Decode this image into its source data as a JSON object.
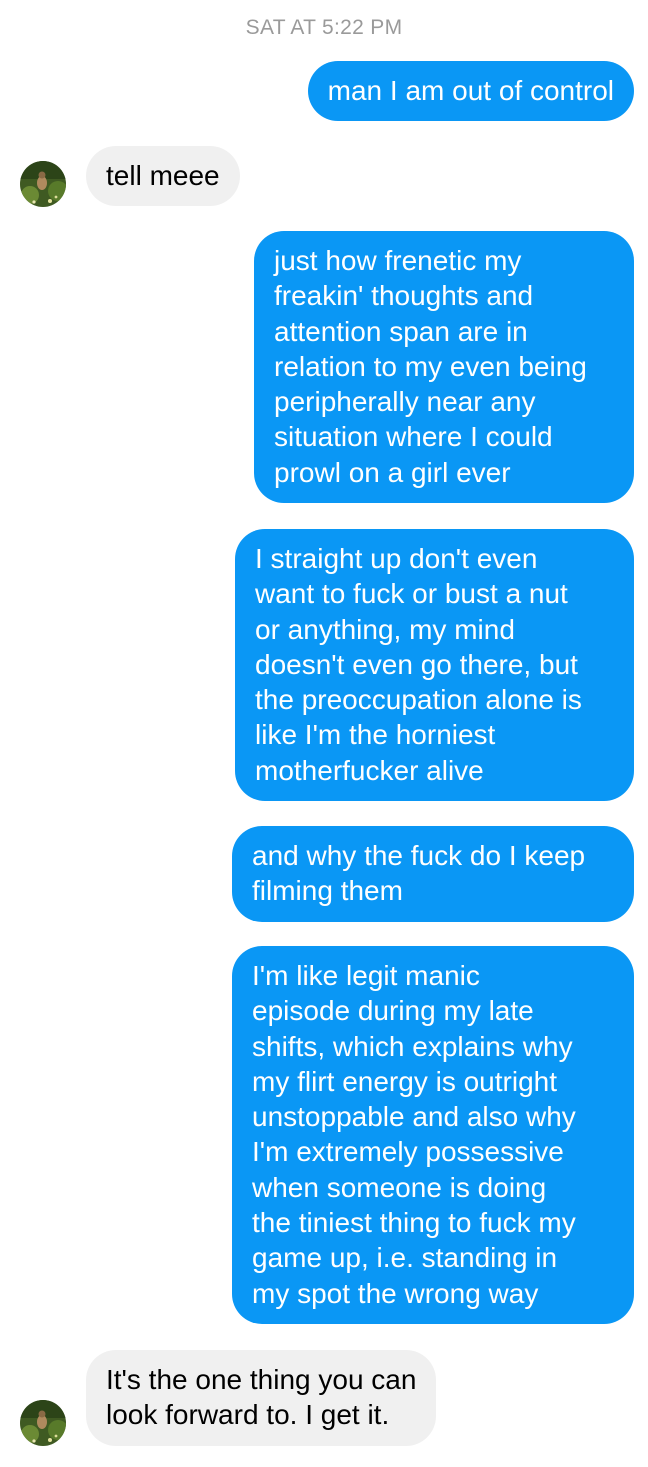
{
  "timestamp": "SAT AT 5:22 PM",
  "colors": {
    "sent_bubble": "#0a97f5",
    "received_bubble": "#f0f0f0",
    "timestamp_text": "#9a9a9a"
  },
  "messages": [
    {
      "from": "me",
      "text": "man I am out of control"
    },
    {
      "from": "them",
      "text": "tell meee"
    },
    {
      "from": "me",
      "text": "just how frenetic my\nfreakin' thoughts and\nattention span are in\nrelation to my even being\nperipherally near any\nsituation where I could\nprowl on a girl ever"
    },
    {
      "from": "me",
      "text": "I straight up don't even\nwant to fuck or bust a nut\nor anything, my mind\ndoesn't even go there, but\nthe preoccupation alone is\nlike I'm the horniest\nmotherfucker alive"
    },
    {
      "from": "me",
      "text": "and why the fuck do I keep\nfilming them"
    },
    {
      "from": "me",
      "text": "I'm like legit manic\nepisode during my late\nshifts, which explains why\nmy flirt energy is outright\nunstoppable and also why\nI'm extremely possessive\nwhen someone is doing\nthe tiniest thing to fuck my\ngame up, i.e. standing in\nmy spot the wrong way"
    },
    {
      "from": "them",
      "text": "It's the one thing you can\nlook forward to. I get it."
    }
  ]
}
